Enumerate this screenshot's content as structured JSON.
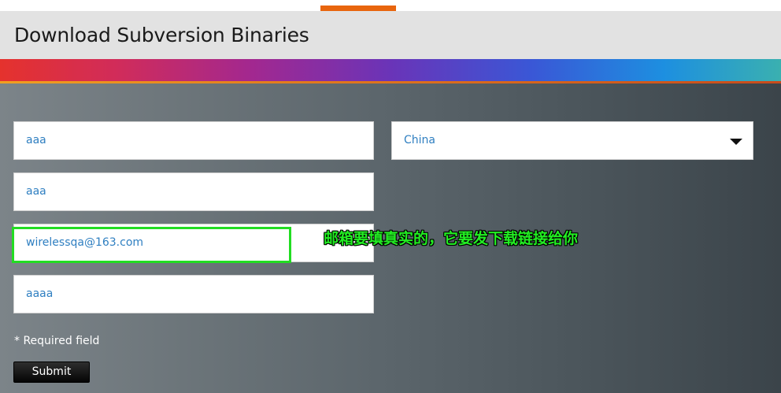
{
  "header": {
    "title": "Download Subversion Binaries"
  },
  "form": {
    "fields": [
      {
        "name": "first-name",
        "value": "aaa"
      },
      {
        "name": "last-name",
        "value": "aaa"
      },
      {
        "name": "email",
        "value": "wirelessqa@163.com"
      },
      {
        "name": "company",
        "value": "aaaa"
      }
    ],
    "country": {
      "selected": "China"
    },
    "required_note": "* Required field",
    "submit_label": "Submit"
  },
  "annotation": {
    "text": "邮箱要填真实的，它要发下载链接给你"
  },
  "colors": {
    "accent_tab": "#e8650d",
    "field_text": "#2f7fc1",
    "annotation": "#22ee22",
    "highlight_border": "#22dd22"
  },
  "icons": {
    "select_arrow": "chevron-down-icon"
  }
}
